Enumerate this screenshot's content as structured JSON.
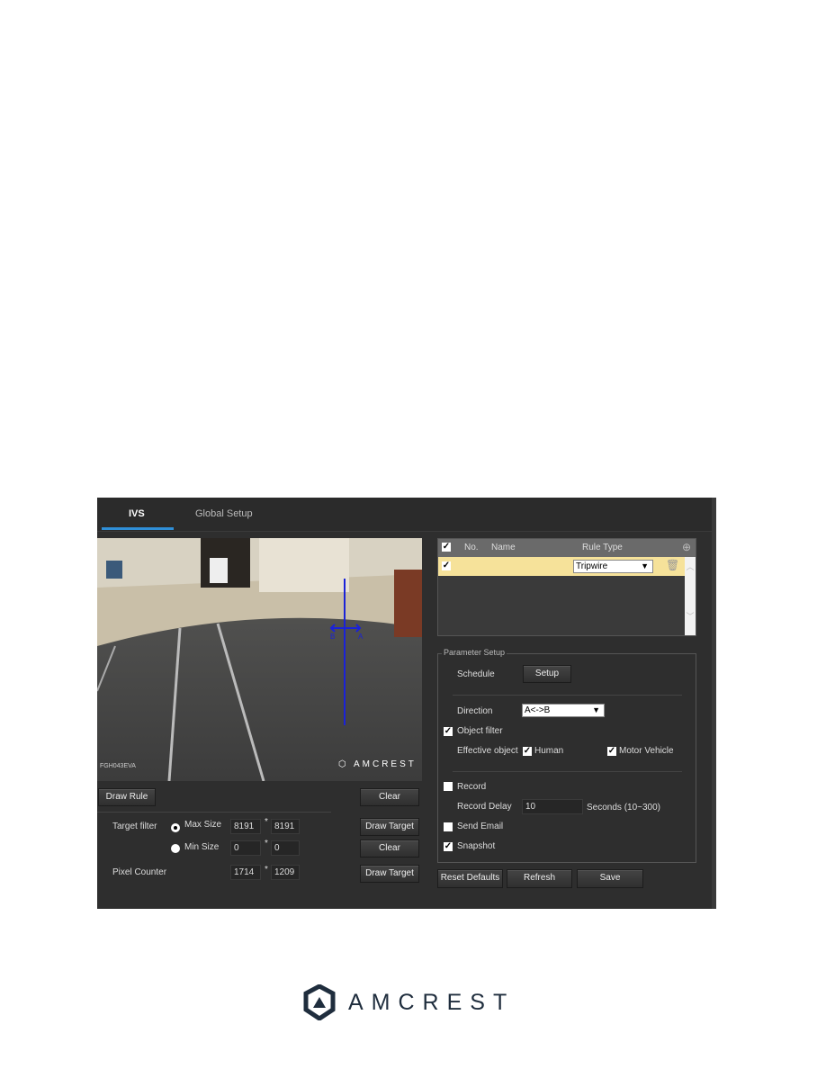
{
  "tabs": [
    {
      "label": "IVS",
      "active": true
    },
    {
      "label": "Global Setup",
      "active": false
    }
  ],
  "video": {
    "overlay_text": "FGH043EVA",
    "brand_logo": "AMCREST",
    "rule_labels": {
      "a": "A",
      "b": "B"
    }
  },
  "left": {
    "draw_rule": "Draw Rule",
    "clear": "Clear",
    "target_filter_label": "Target filter",
    "max_size": {
      "label": "Max Size",
      "selected": true,
      "w": "8191",
      "h": "8191"
    },
    "min_size": {
      "label": "Min Size",
      "selected": false,
      "w": "0",
      "h": "0"
    },
    "times": "*",
    "draw_target": "Draw Target",
    "pixel_counter": {
      "label": "Pixel Counter",
      "w": "1714",
      "h": "1209"
    }
  },
  "rules_table": {
    "headers": {
      "no": "No.",
      "name": "Name",
      "type": "Rule Type"
    },
    "header_checked": true,
    "rows": [
      {
        "checked": true,
        "rule_type": "Tripwire"
      }
    ],
    "highlight_color": "#f6e29a"
  },
  "params": {
    "legend": "Parameter Setup",
    "schedule_label": "Schedule",
    "setup_button": "Setup",
    "direction_label": "Direction",
    "direction_value": "A<->B",
    "object_filter": {
      "label": "Object filter",
      "checked": true
    },
    "effective_object_label": "Effective object",
    "human": {
      "label": "Human",
      "checked": true
    },
    "motor_vehicle": {
      "label": "Motor Vehicle",
      "checked": true
    },
    "record": {
      "label": "Record",
      "checked": false
    },
    "record_delay_label": "Record Delay",
    "record_delay_value": "10",
    "record_delay_hint": "Seconds (10~300)",
    "send_email": {
      "label": "Send Email",
      "checked": false
    },
    "snapshot": {
      "label": "Snapshot",
      "checked": true
    }
  },
  "buttons": {
    "reset": "Reset Defaults",
    "refresh": "Refresh",
    "save": "Save"
  },
  "footer": {
    "logo_text": "AMCREST"
  },
  "colors": {
    "accent": "#2f8fd8",
    "rule_line": "#1a22d8"
  }
}
